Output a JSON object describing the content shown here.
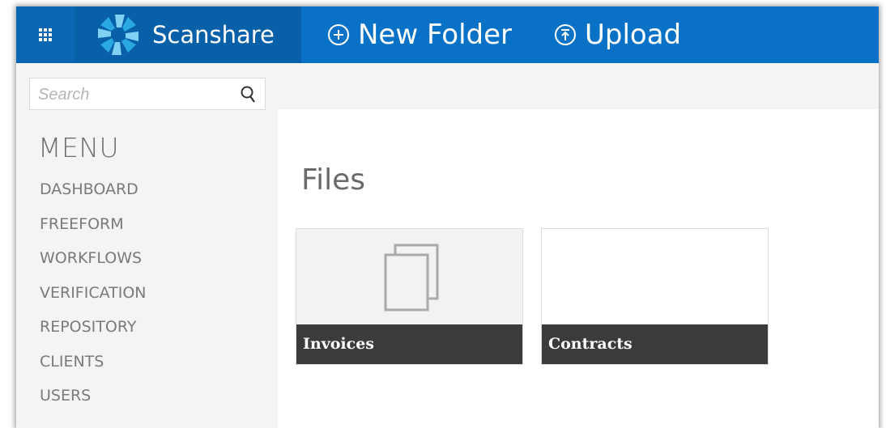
{
  "header": {
    "app_name": "Scanshare",
    "new_folder_label": "New Folder",
    "upload_label": "Upload",
    "colors": {
      "bar": "#0a72c6",
      "brand_bg": "#0861a8",
      "waffle_bg": "#0b66b3"
    }
  },
  "sidebar": {
    "search_placeholder": "Search",
    "menu_title": "MENU",
    "items": [
      {
        "label": "DASHBOARD"
      },
      {
        "label": "FREEFORM"
      },
      {
        "label": "WORKFLOWS"
      },
      {
        "label": "VERIFICATION"
      },
      {
        "label": "REPOSITORY"
      },
      {
        "label": "CLIENTS"
      },
      {
        "label": "USERS"
      }
    ]
  },
  "main": {
    "title": "Files",
    "folders": [
      {
        "name": "Invoices",
        "icon": "documents-icon"
      },
      {
        "name": "Contracts",
        "icon": ""
      }
    ]
  }
}
